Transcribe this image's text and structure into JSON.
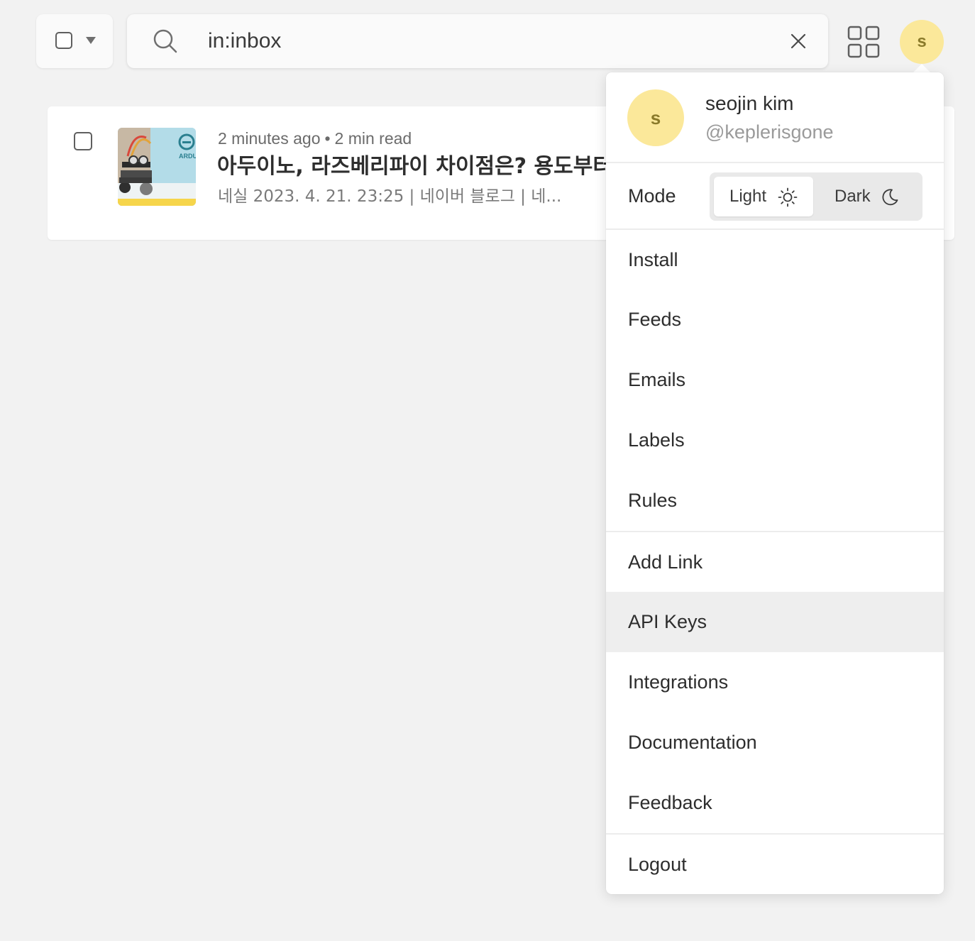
{
  "toolbar": {
    "search_query": "in:inbox"
  },
  "avatar": {
    "initial": "s",
    "color": "#fbe89a"
  },
  "article": {
    "time_ago": "2 minutes ago",
    "separator": "•",
    "read_time": "2 min read",
    "title": "아두이노, 라즈베리파이 차이점은? 용도부터",
    "snippet": "네실 2023. 4. 21. 23:25 | 네이버 블로그 | 네..."
  },
  "menu": {
    "user_name": "seojin kim",
    "user_handle": "@keplerisgone",
    "mode_label": "Mode",
    "mode_light": "Light",
    "mode_dark": "Dark",
    "mode_selected": "Light",
    "items": [
      {
        "label": "Install"
      },
      {
        "label": "Feeds"
      },
      {
        "label": "Emails"
      },
      {
        "label": "Labels"
      },
      {
        "label": "Rules"
      },
      {
        "label": "Add Link"
      },
      {
        "label": "API Keys"
      },
      {
        "label": "Integrations"
      },
      {
        "label": "Documentation"
      },
      {
        "label": "Feedback"
      },
      {
        "label": "Logout"
      }
    ],
    "highlighted_item": "API Keys"
  },
  "icons": {
    "search": "search-icon",
    "clear": "close-icon",
    "apps": "grid-icon",
    "light": "sun-icon",
    "dark": "moon-icon",
    "dropdown": "caret-down-icon"
  }
}
